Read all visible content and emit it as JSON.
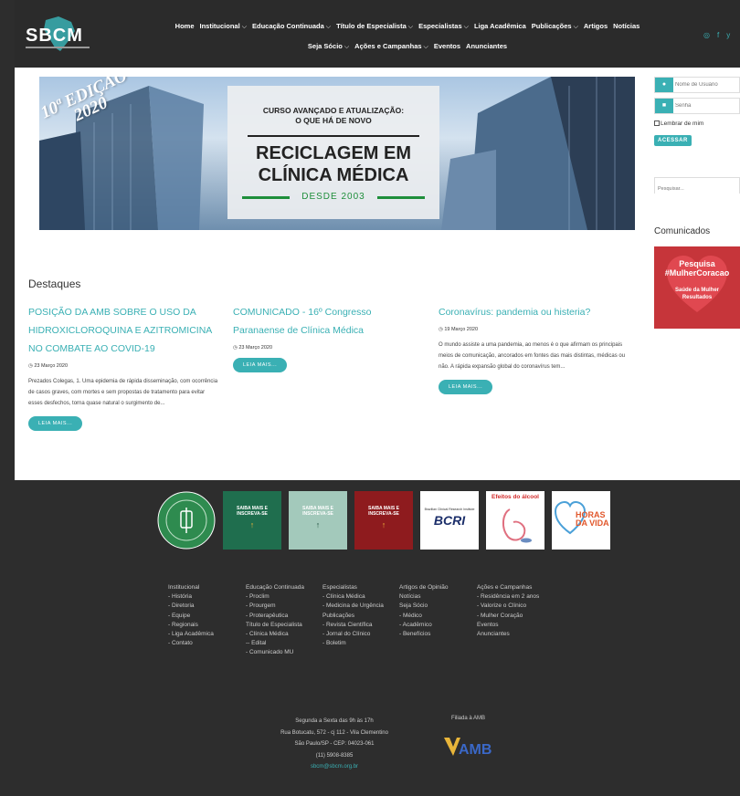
{
  "header": {
    "logo_text": "SBCM",
    "nav_row1": [
      {
        "label": "Home",
        "chevron": false
      },
      {
        "label": "Institucional",
        "chevron": true
      },
      {
        "label": "Educação Continuada",
        "chevron": true
      },
      {
        "label": "Título de Especialista",
        "chevron": true
      },
      {
        "label": "Especialistas",
        "chevron": true
      },
      {
        "label": "Liga Acadêmica",
        "chevron": false
      },
      {
        "label": "Publicações",
        "chevron": true
      },
      {
        "label": "Artigos",
        "chevron": false
      },
      {
        "label": "Notícias",
        "chevron": false
      }
    ],
    "nav_row2": [
      {
        "label": "Seja Sócio",
        "chevron": true
      },
      {
        "label": "Ações e Campanhas",
        "chevron": true
      },
      {
        "label": "Eventos",
        "chevron": false
      },
      {
        "label": "Anunciantes",
        "chevron": false
      }
    ],
    "chevron_glyph": "⌵"
  },
  "banner": {
    "edition": "10ª EDIÇÃO\n2020",
    "subtitle": "CURSO AVANÇADO E ATUALIZAÇÃO:\nO QUE HÁ DE NOVO",
    "title": "RECICLAGEM EM\nCLÍNICA MÉDICA",
    "since": "DESDE 2003"
  },
  "sidebar": {
    "username_placeholder": "Nome de Usuário",
    "password_placeholder": "Senha",
    "remember_label": "Lembrar de mim",
    "access_button": "ACESSAR",
    "search_placeholder": "Pesquisar...",
    "comunicados_title": "Comunicados",
    "campaign_line1": "Pesquisa",
    "campaign_line2": "#MulherCoracao",
    "campaign_line3": "Saúde da Mulher\nResultados"
  },
  "highlights": {
    "title": "Destaques",
    "posts": [
      {
        "title": "POSIÇÃO DA AMB SOBRE O USO DA HIDROXICLOROQUINA E AZITROMICINA NO COMBATE AO COVID-19",
        "date": "23 Março 2020",
        "excerpt": "Prezados Colegas, 1. Uma epidemia de rápida disseminação, com ocorrência de casos graves, com mortes e sem propostas de tratamento para evitar esses desfechos, torna quase natural o surgimento de...",
        "more": "LEIA MAIS..."
      },
      {
        "title": "COMUNICADO - 16º Congresso Paranaense de Clínica Médica",
        "date": "23 Março 2020",
        "excerpt": "",
        "more": "LEIA MAIS..."
      },
      {
        "title": "Coronavírus: pandemia ou histeria?",
        "date": "19 Março 2020",
        "excerpt": "O mundo assiste a uma pandemia, ao menos é o que afirmam os principais meios de comunicação, ancorados em fontes das mais distintas, médicas ou não. A rápida expansão global do coronavírus tem...",
        "more": "LEIA MAIS..."
      }
    ]
  },
  "footer": {
    "partners": [
      {
        "name": "seal",
        "text": "SOCIEDADE BRASILEIRA DE CLÍNICA MÉDICA",
        "year": "2016"
      },
      {
        "name": "saiba1",
        "text": "SAIBA MAIS E\nINSCREVA-SE",
        "color": "#1f6e4e"
      },
      {
        "name": "saiba2",
        "text": "SAIBA MAIS E\nINSCREVA-SE",
        "color": "#a3c9bb"
      },
      {
        "name": "saiba3",
        "text": "SAIBA MAIS E\nINSCREVA-SE",
        "color": "#8e1b1e"
      },
      {
        "name": "bcri",
        "text": "BCRI",
        "caption": "Brazilian Clinical Research Institute"
      },
      {
        "name": "alcool",
        "text": "Efeitos do álcool"
      },
      {
        "name": "horas",
        "text": "HORAS\nDA VIDA"
      }
    ],
    "col1": [
      "Institucional",
      "- História",
      "- Diretoria",
      "- Equipe",
      "- Regionais",
      "- Liga Acadêmica",
      "- Contato"
    ],
    "col2": [
      "Educação Continuada",
      "- Proclim",
      "- Prourgem",
      "- Proterapêutica",
      "Título de Especialista",
      "- Clínica Médica",
      "-- Edital",
      "- Comunicado MU"
    ],
    "col3": [
      "Especialistas",
      "- Clínica Médica",
      "- Medicina de Urgência",
      "Publicações",
      "- Revista Científica",
      "- Jornal do Clínico",
      "- Boletim"
    ],
    "col4": [
      "Artigos de Opinião",
      "Notícias",
      "Seja Sócio",
      "- Médico",
      "- Acadêmico",
      "- Benefícios"
    ],
    "col5": [
      "Ações e Campanhas",
      "- Residência em 2 anos",
      "- Valorize o Clínico",
      "- Mulher Coração",
      "Eventos",
      "Anunciantes"
    ],
    "hours": "Segunda a Sexta das 9h às 17h",
    "address": "Rua Botucatu, 572 - cj 112 - Vila Clementino",
    "city": "São Paulo/SP - CEP: 04023-061",
    "phone": "(11) 5908-8385",
    "email": "sbcm@sbcm.org.br",
    "filiada": "Filiada à AMB",
    "amb": "AMB"
  },
  "colors": {
    "accent": "#3ab0b4",
    "dark": "#2d2d2d"
  }
}
